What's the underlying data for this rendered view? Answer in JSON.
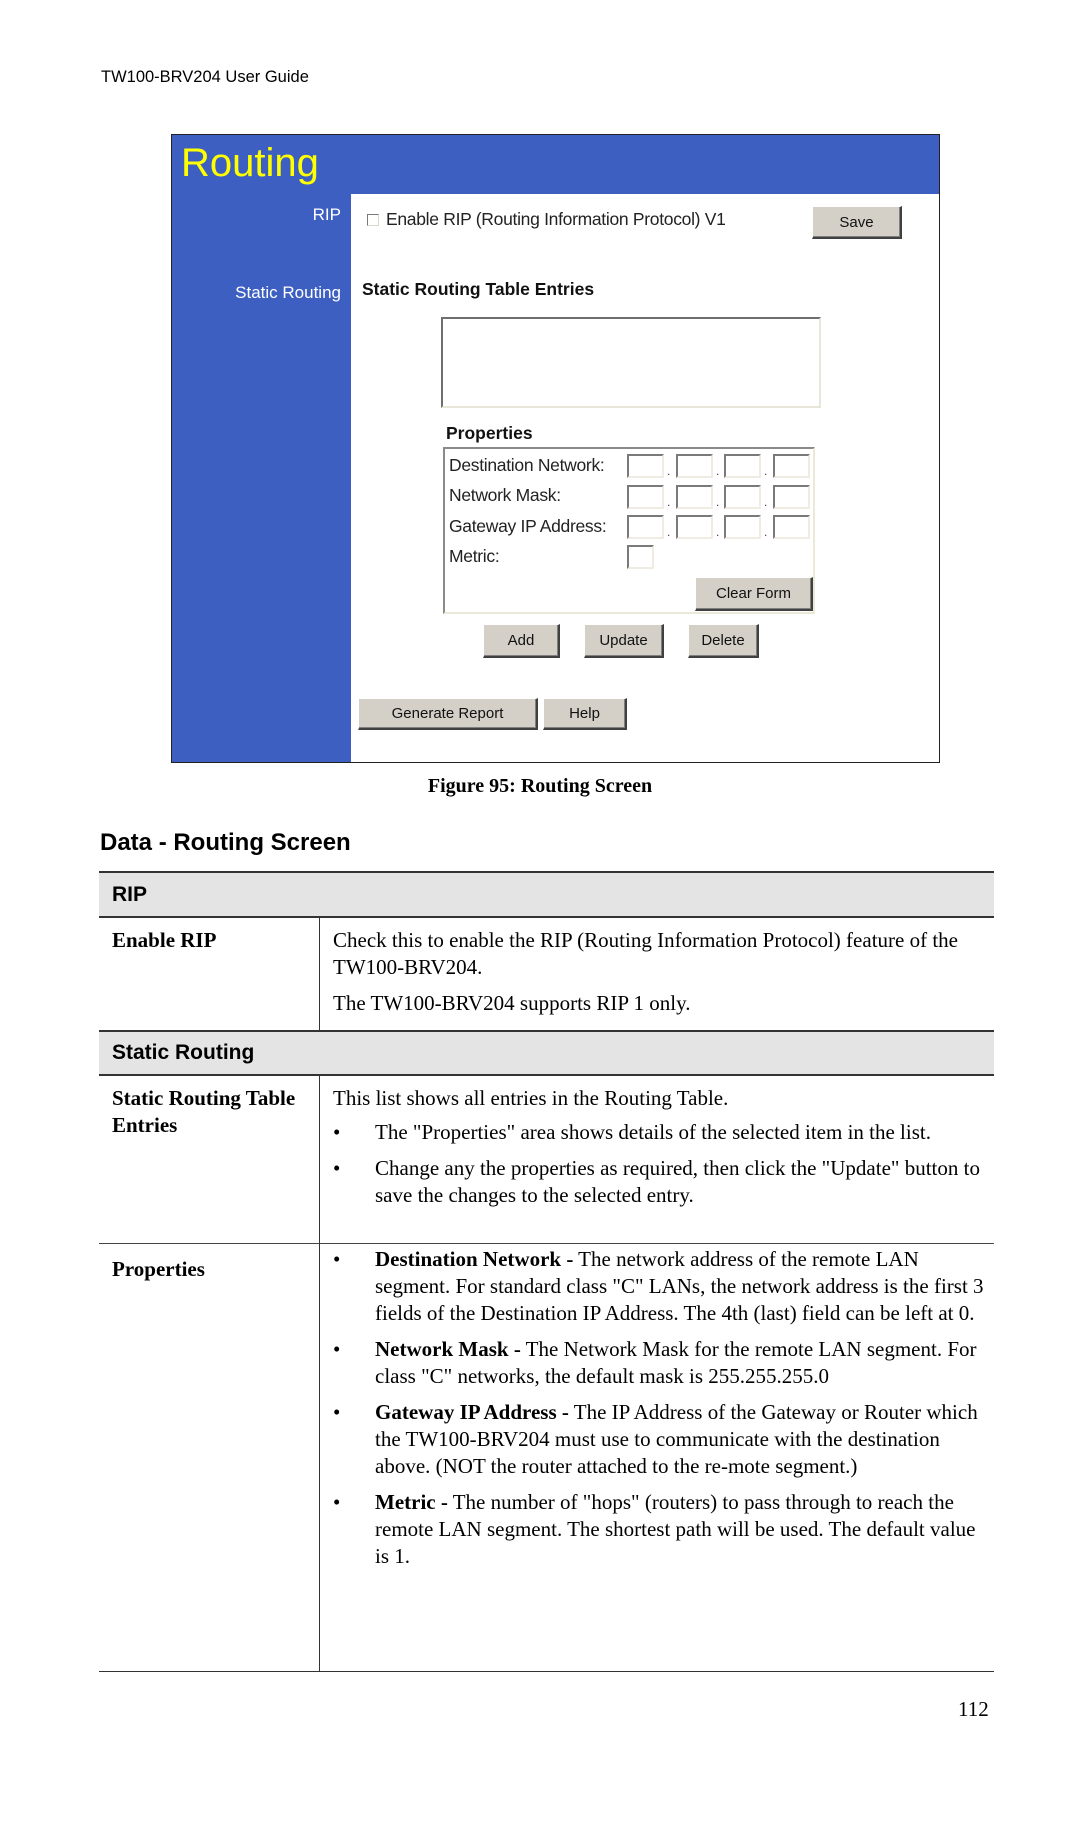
{
  "page": {
    "running_header": "TW100-BRV204 User Guide",
    "page_number": "112"
  },
  "figure": {
    "title": "Routing",
    "sidebar": {
      "rip_label": "RIP",
      "static_routing_label": "Static Routing"
    },
    "rip": {
      "checkbox_label": "Enable RIP (Routing Information Protocol) V1",
      "checked": false,
      "save_button": "Save"
    },
    "static_routing": {
      "table_heading": "Static Routing Table Entries",
      "entries": [],
      "properties_heading": "Properties",
      "fields": {
        "destination_network": {
          "label": "Destination Network:",
          "values": [
            "",
            "",
            "",
            ""
          ]
        },
        "network_mask": {
          "label": "Network Mask:",
          "values": [
            "",
            "",
            "",
            ""
          ]
        },
        "gateway_ip": {
          "label": "Gateway IP Address:",
          "values": [
            "",
            "",
            "",
            ""
          ]
        },
        "metric": {
          "label": "Metric:",
          "value": ""
        }
      },
      "separator": ".",
      "clear_form_button": "Clear Form",
      "add_button": "Add",
      "update_button": "Update",
      "delete_button": "Delete"
    },
    "generate_report_button": "Generate Report",
    "help_button": "Help",
    "caption": "Figure 95: Routing Screen"
  },
  "data_section": {
    "heading": "Data - Routing Screen",
    "rip_band": "RIP",
    "enable_rip": {
      "label": "Enable RIP",
      "paragraphs": [
        "Check this to enable the RIP (Routing Information Protocol) feature of the TW100-BRV204.",
        "The TW100-BRV204 supports RIP 1 only."
      ]
    },
    "static_routing_band": "Static Routing",
    "table_entries": {
      "label": "Static Routing Table Entries",
      "intro": "This list shows all entries in the Routing Table.",
      "bullets": [
        "The \"Properties\" area shows details of the selected item in the list.",
        "Change any the properties as required, then click the \"Update\" button to save the changes to the selected entry."
      ]
    },
    "properties": {
      "label": "Properties",
      "bullets": [
        {
          "term": "Destination Network -",
          "text": " The network address of the remote LAN segment. For standard class \"C\" LANs, the network address is the first 3 fields of the Destination IP Address. The 4th (last) field can be left at 0."
        },
        {
          "term": "Network Mask -",
          "text": " The Network Mask for the remote LAN segment. For class \"C\" networks, the default mask is 255.255.255.0"
        },
        {
          "term": "Gateway IP Address -",
          "text": " The IP Address of the Gateway or Router which the TW100-BRV204 must use to communicate with the destination above. (NOT the router attached to the re-mote segment.)"
        },
        {
          "term": "Metric -",
          "text": " The number of \"hops\" (routers) to pass through to reach the remote LAN segment. The shortest path will be used. The default value is 1."
        }
      ]
    }
  }
}
